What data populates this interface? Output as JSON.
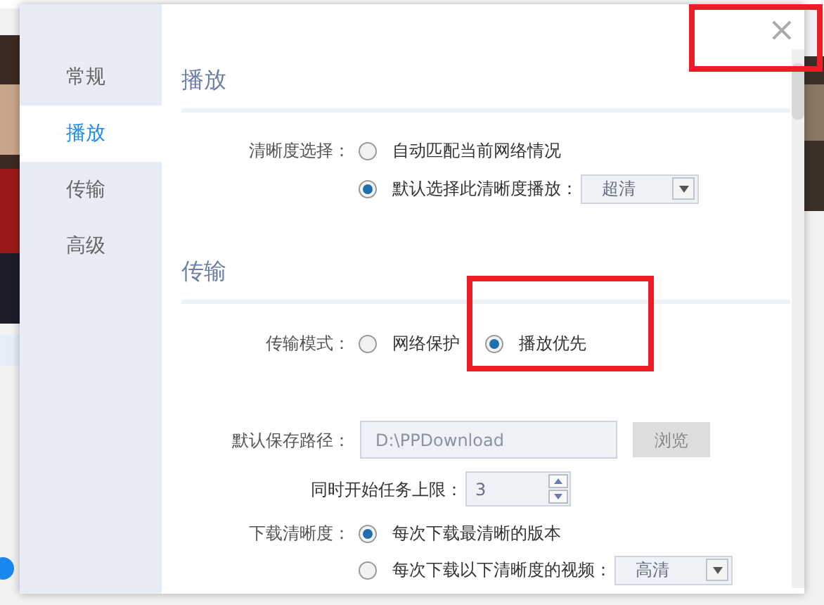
{
  "sidebar": {
    "items": [
      {
        "label": "常规",
        "selected": false
      },
      {
        "label": "播放",
        "selected": true
      },
      {
        "label": "传输",
        "selected": false
      },
      {
        "label": "高级",
        "selected": false
      }
    ]
  },
  "close": "×",
  "sections": [
    {
      "title": "播放",
      "rows": [
        {
          "kind": "radio",
          "label": "清晰度选择：",
          "options": [
            {
              "text": "自动匹配当前网络情况",
              "selected": false
            },
            {
              "text": "默认选择此清晰度播放：",
              "selected": true,
              "dropdown": "超清"
            }
          ]
        }
      ]
    },
    {
      "title": "传输",
      "rows": [
        {
          "kind": "inline-radio",
          "label": "传输模式：",
          "options": [
            {
              "text": "网络保护",
              "selected": false
            },
            {
              "text": "播放优先",
              "selected": true
            }
          ]
        },
        {
          "kind": "path",
          "label": "默认保存路径：",
          "value": "D:\\PPDownload",
          "button": "浏览"
        },
        {
          "kind": "spinner",
          "label": "同时开始任务上限：",
          "value": "3"
        },
        {
          "kind": "radio",
          "label": "下载清晰度：",
          "options": [
            {
              "text": "每次下载最清晰的版本",
              "selected": true
            },
            {
              "text": "每次下载以下清晰度的视频：",
              "selected": false,
              "dropdown": "高清"
            }
          ]
        }
      ]
    }
  ]
}
